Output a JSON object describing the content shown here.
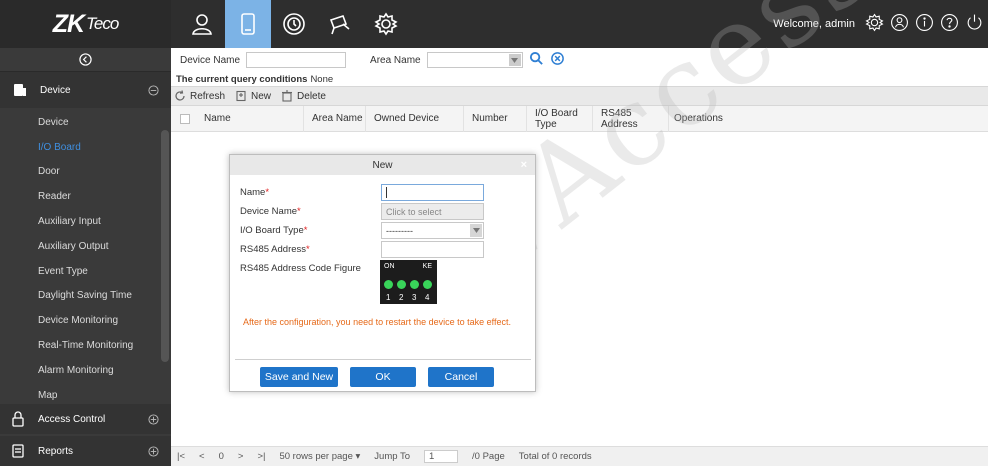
{
  "brand": {
    "logo_main": "ZK",
    "logo_sub": "Teco"
  },
  "header": {
    "welcome": "Welcome, admin",
    "modules": [
      "person-icon",
      "door-device-icon",
      "clock-icon",
      "camera-icon",
      "gear-icon"
    ]
  },
  "sidebar": {
    "section": "Device",
    "items": [
      {
        "label": "Device",
        "active": false
      },
      {
        "label": "I/O Board",
        "active": true
      },
      {
        "label": "Door",
        "active": false
      },
      {
        "label": "Reader",
        "active": false
      },
      {
        "label": "Auxiliary Input",
        "active": false
      },
      {
        "label": "Auxiliary Output",
        "active": false
      },
      {
        "label": "Event Type",
        "active": false
      },
      {
        "label": "Daylight Saving Time",
        "active": false
      },
      {
        "label": "Device Monitoring",
        "active": false
      },
      {
        "label": "Real-Time Monitoring",
        "active": false
      },
      {
        "label": "Alarm Monitoring",
        "active": false
      },
      {
        "label": "Map",
        "active": false
      }
    ],
    "section_access": "Access Control",
    "section_reports": "Reports"
  },
  "query": {
    "device_name_label": "Device Name",
    "device_name_value": "",
    "area_name_label": "Area Name",
    "conditions_label": "The current query conditions",
    "conditions_value": "None"
  },
  "toolbar": {
    "refresh": "Refresh",
    "new": "New",
    "delete": "Delete"
  },
  "table": {
    "columns": [
      "Name",
      "Area Name",
      "Owned Device",
      "Number",
      "I/O Board Type",
      "RS485 Address",
      "Operations"
    ]
  },
  "pager": {
    "page_current": "0",
    "rows_per_page": "50 rows per page",
    "jump_to": "Jump To",
    "jump_value": "1",
    "page_total": "/0 Page",
    "records": "Total of 0 records"
  },
  "watermark": "CVAccess",
  "dialog": {
    "title": "New",
    "close": "×",
    "name_label": "Name",
    "name_value": "",
    "device_name_label": "Device Name",
    "device_name_placeholder": "Click to select",
    "board_type_label": "I/O Board Type",
    "board_type_value": "---------",
    "rs485_label": "RS485 Address",
    "rs485_value": "",
    "code_figure_label": "RS485 Address Code Figure",
    "dip": {
      "on": "ON",
      "ke": "KE",
      "numbers": [
        "1",
        "2",
        "3",
        "4"
      ]
    },
    "note": "After the configuration, you need to restart the device to take effect.",
    "save_and_new": "Save and New",
    "ok": "OK",
    "cancel": "Cancel"
  },
  "colors": {
    "accent": "#1f74c9",
    "active_menu": "#3f8fe0",
    "note": "#e66a1a",
    "dip_on": "#39d45a"
  }
}
